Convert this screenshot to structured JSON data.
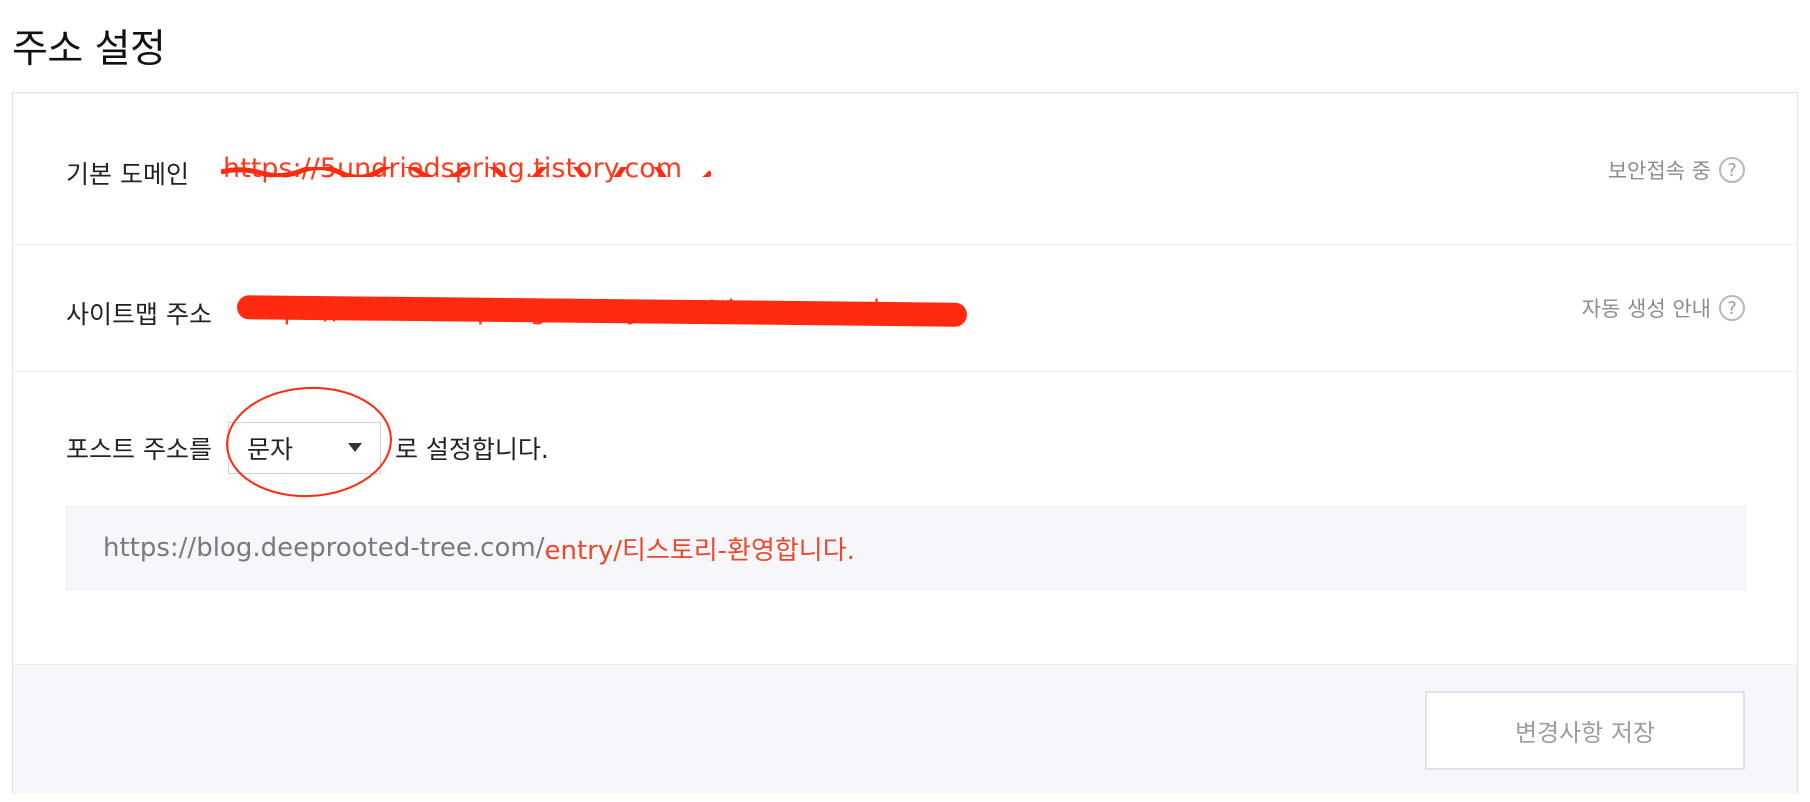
{
  "page": {
    "title": "주소 설정"
  },
  "domain": {
    "label": "기본 도메인",
    "value": "https://5undriedspring.tistory.com",
    "help_text": "보안접속 중",
    "help_icon": "question-circle-icon"
  },
  "sitemap": {
    "label": "사이트맵 주소",
    "value": "https://5undriedspring.tistory.com/sitemap.xml",
    "help_text": "자동 생성 안내",
    "help_icon": "question-circle-icon"
  },
  "post": {
    "prefix": "포스트 주소를",
    "selected": "문자",
    "suffix": "로 설정합니다.",
    "arrow_icon": "dropdown-triangle-icon",
    "preview_base": "https://blog.deeprooted-tree.com/",
    "preview_accent": "entry/티스토리-환영합니다."
  },
  "footer": {
    "save_label": "변경사항 저장"
  },
  "colors": {
    "accent": "#f0472c",
    "redaction": "#ff2a10",
    "border": "#dfe2ea",
    "muted_text": "#8a8d94"
  }
}
